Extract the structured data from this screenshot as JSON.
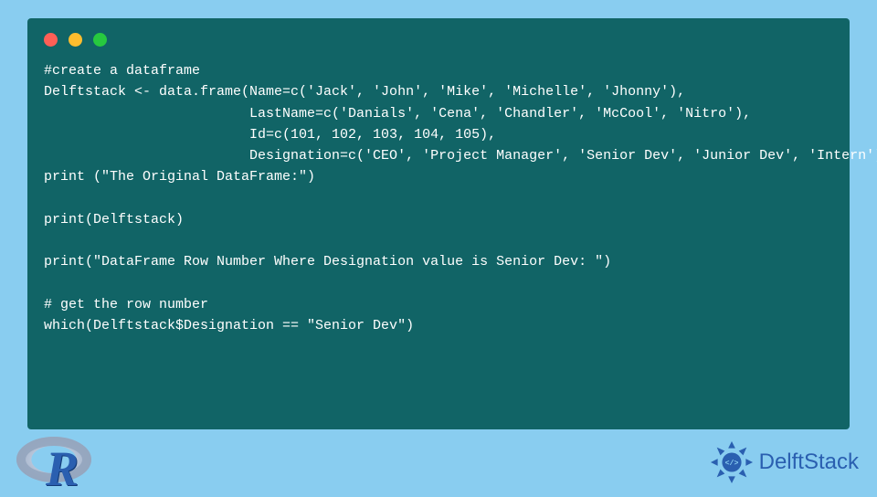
{
  "code": {
    "lines": [
      "#create a dataframe",
      "Delftstack <- data.frame(Name=c('Jack', 'John', 'Mike', 'Michelle', 'Jhonny'),",
      "                         LastName=c('Danials', 'Cena', 'Chandler', 'McCool', 'Nitro'),",
      "                         Id=c(101, 102, 103, 104, 105),",
      "                         Designation=c('CEO', 'Project Manager', 'Senior Dev', 'Junior Dev', 'Intern'))",
      "print (\"The Original DataFrame:\")",
      "",
      "print(Delftstack)",
      "",
      "print(\"DataFrame Row Number Where Designation value is Senior Dev: \")",
      "",
      "# get the row number",
      "which(Delftstack$Designation == \"Senior Dev\")"
    ]
  },
  "r_logo": {
    "glyph": "R"
  },
  "delftstack": {
    "label": "DelftStack",
    "icon_glyph": "</>"
  },
  "window": {
    "dots": [
      {
        "color": "#ff5f56"
      },
      {
        "color": "#ffbd2e"
      },
      {
        "color": "#27c93f"
      }
    ],
    "bg": "#116466"
  }
}
